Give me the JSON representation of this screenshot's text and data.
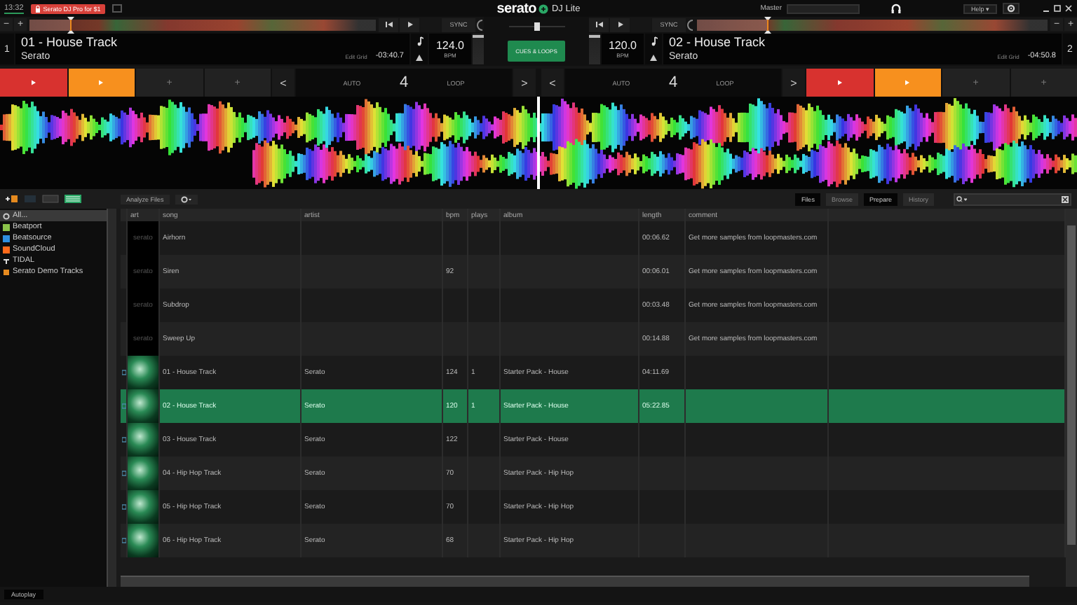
{
  "top_bar": {
    "clock": "13:32",
    "promo_button": "Serato DJ Pro for $1",
    "logo": "serato",
    "product": "DJ Lite",
    "master_label": "Master",
    "help_button": "Help ▾"
  },
  "decks": [
    {
      "number": "1",
      "title": "01 - House Track",
      "artist": "Serato",
      "edit_grid": "Edit Grid",
      "time": "-03:40.7",
      "bpm": "124.0",
      "bpm_label": "BPM",
      "sync": "SYNC",
      "zoom_out": "−",
      "zoom_in": "+",
      "progress": {
        "level": 0.12
      },
      "pitch": {
        "level": 0.9
      },
      "pads": [
        {
          "kind": "play",
          "color": "#d8322f"
        },
        {
          "kind": "play",
          "color": "#f7901e"
        },
        {
          "kind": "add",
          "label": "+"
        },
        {
          "kind": "add",
          "label": "+"
        }
      ],
      "loop": {
        "prev": "<",
        "auto": "AUTO",
        "size": "4",
        "label": "LOOP",
        "next": ">"
      }
    },
    {
      "number": "2",
      "title": "02 - House Track",
      "artist": "Serato",
      "edit_grid": "Edit Grid",
      "time": "-04:50.8",
      "bpm": "120.0",
      "bpm_label": "BPM",
      "sync": "SYNC",
      "zoom_out": "−",
      "zoom_in": "+",
      "progress": {
        "level": 0.2
      },
      "pitch": {
        "level": 0.9
      },
      "pads": [
        {
          "kind": "play",
          "color": "#d8322f"
        },
        {
          "kind": "play",
          "color": "#f7901e"
        },
        {
          "kind": "add",
          "label": "+"
        },
        {
          "kind": "add",
          "label": "+"
        }
      ],
      "loop": {
        "prev": "<",
        "auto": "AUTO",
        "size": "4",
        "label": "LOOP",
        "next": ">"
      }
    }
  ],
  "mixer": {
    "cues_loops_button": "CUES & LOOPS"
  },
  "library": {
    "toolbar": {
      "analyze_button": "Analyze Files",
      "views": [
        {
          "label": "Files",
          "enabled": true
        },
        {
          "label": "Browse",
          "enabled": false
        },
        {
          "label": "Prepare",
          "enabled": true
        },
        {
          "label": "History",
          "enabled": false
        }
      ]
    },
    "sidebar": {
      "items": [
        {
          "label": "All...",
          "kind": "all",
          "selected": true
        },
        {
          "label": "Beatport",
          "kind": "beatport",
          "selected": false
        },
        {
          "label": "Beatsource",
          "kind": "beatsource",
          "selected": false
        },
        {
          "label": "SoundCloud",
          "kind": "soundcloud",
          "selected": false
        },
        {
          "label": "TIDAL",
          "kind": "tidal",
          "selected": false
        },
        {
          "label": "Serato Demo Tracks",
          "kind": "crate",
          "selected": false
        }
      ]
    },
    "table": {
      "columns": [
        "art",
        "song",
        "artist",
        "bpm",
        "plays",
        "album",
        "length",
        "comment"
      ],
      "rows": [
        {
          "kind": "sample",
          "art": "serato",
          "song": "Airhorn",
          "length": "00:06.62",
          "comment": "Get more samples from loopmasters.com",
          "selected": false
        },
        {
          "kind": "sample",
          "art": "serato",
          "song": "Siren",
          "bpm": "92",
          "length": "00:06.01",
          "comment": "Get more samples from loopmasters.com",
          "selected": false
        },
        {
          "kind": "sample",
          "art": "serato",
          "song": "Subdrop",
          "length": "00:03.48",
          "comment": "Get more samples from loopmasters.com",
          "selected": false
        },
        {
          "kind": "sample",
          "art": "serato",
          "song": "Sweep Up",
          "length": "00:14.88",
          "comment": "Get more samples from loopmasters.com",
          "selected": false
        },
        {
          "kind": "track",
          "song": "01 - House Track",
          "artist": "Serato",
          "bpm": "124",
          "plays": "1",
          "album": "Starter Pack - House",
          "length": "04:11.69",
          "selected": false
        },
        {
          "kind": "track",
          "song": "02 - House Track",
          "artist": "Serato",
          "bpm": "120",
          "plays": "1",
          "album": "Starter Pack - House",
          "length": "05:22.85",
          "selected": true
        },
        {
          "kind": "track",
          "song": "03 - House Track",
          "artist": "Serato",
          "bpm": "122",
          "album": "Starter Pack - House",
          "selected": false
        },
        {
          "kind": "track",
          "song": "04 - Hip Hop Track",
          "artist": "Serato",
          "bpm": "70",
          "album": "Starter Pack - Hip Hop",
          "selected": false
        },
        {
          "kind": "track",
          "song": "05 - Hip Hop Track",
          "artist": "Serato",
          "bpm": "70",
          "album": "Starter Pack - Hip Hop",
          "selected": false
        },
        {
          "kind": "track",
          "song": "06 - Hip Hop Track",
          "artist": "Serato",
          "bpm": "68",
          "album": "Starter Pack - Hip Hop",
          "selected": false
        }
      ]
    }
  },
  "autoplay_button": "Autoplay"
}
